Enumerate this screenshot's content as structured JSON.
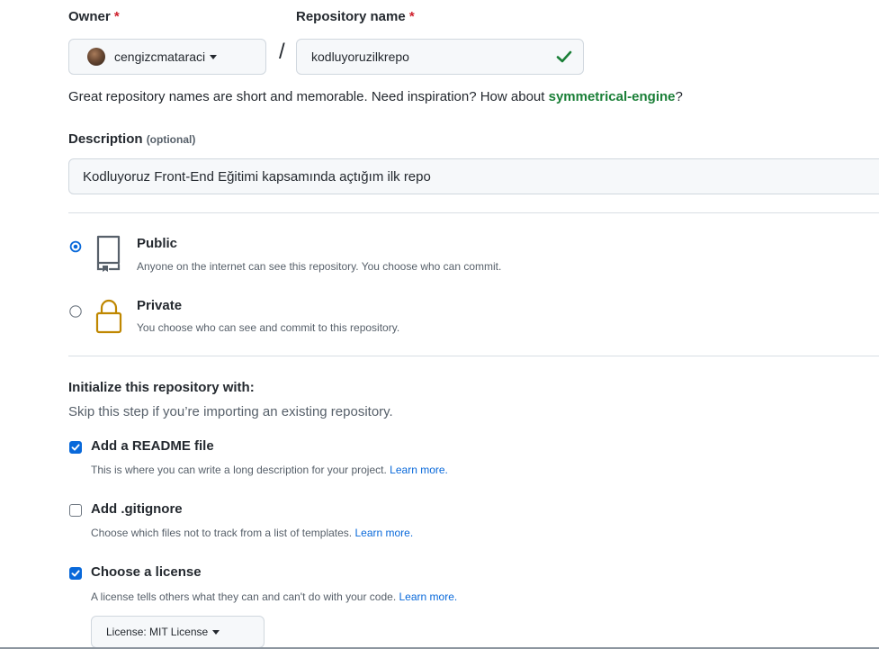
{
  "owner": {
    "label": "Owner",
    "required_mark": "*",
    "value": "cengizcmataraci"
  },
  "repository": {
    "label": "Repository name",
    "required_mark": "*",
    "value": "kodluyoruzilkrepo",
    "separator": "/"
  },
  "name_hint": {
    "text": "Great repository names are short and memorable. Need inspiration? How about ",
    "suggestion": "symmetrical-engine",
    "end": "?"
  },
  "description": {
    "label": "Description",
    "optional": "(optional)",
    "value": "Kodluyoruz Front-End Eğitimi kapsamında açtığım ilk repo"
  },
  "visibility": {
    "public": {
      "title": "Public",
      "description": "Anyone on the internet can see this repository. You choose who can commit.",
      "selected": true
    },
    "private": {
      "title": "Private",
      "description": "You choose who can see and commit to this repository.",
      "selected": false
    }
  },
  "initialize": {
    "title": "Initialize this repository with:",
    "subtitle": "Skip this step if you’re importing an existing repository.",
    "readme": {
      "label": "Add a README file",
      "description": "This is where you can write a long description for your project.",
      "link": "Learn more.",
      "checked": true
    },
    "gitignore": {
      "label": "Add .gitignore",
      "description": "Choose which files not to track from a list of templates.",
      "link": "Learn more.",
      "checked": false
    },
    "license": {
      "label": "Choose a license",
      "description": "A license tells others what they can and can't do with your code.",
      "link": "Learn more.",
      "checked": true,
      "select_value": "License: MIT License"
    }
  },
  "colors": {
    "accent_blue": "#0969da",
    "success_green": "#1a7f37",
    "required_red": "#cf222e",
    "private_lock": "#bf8700"
  }
}
